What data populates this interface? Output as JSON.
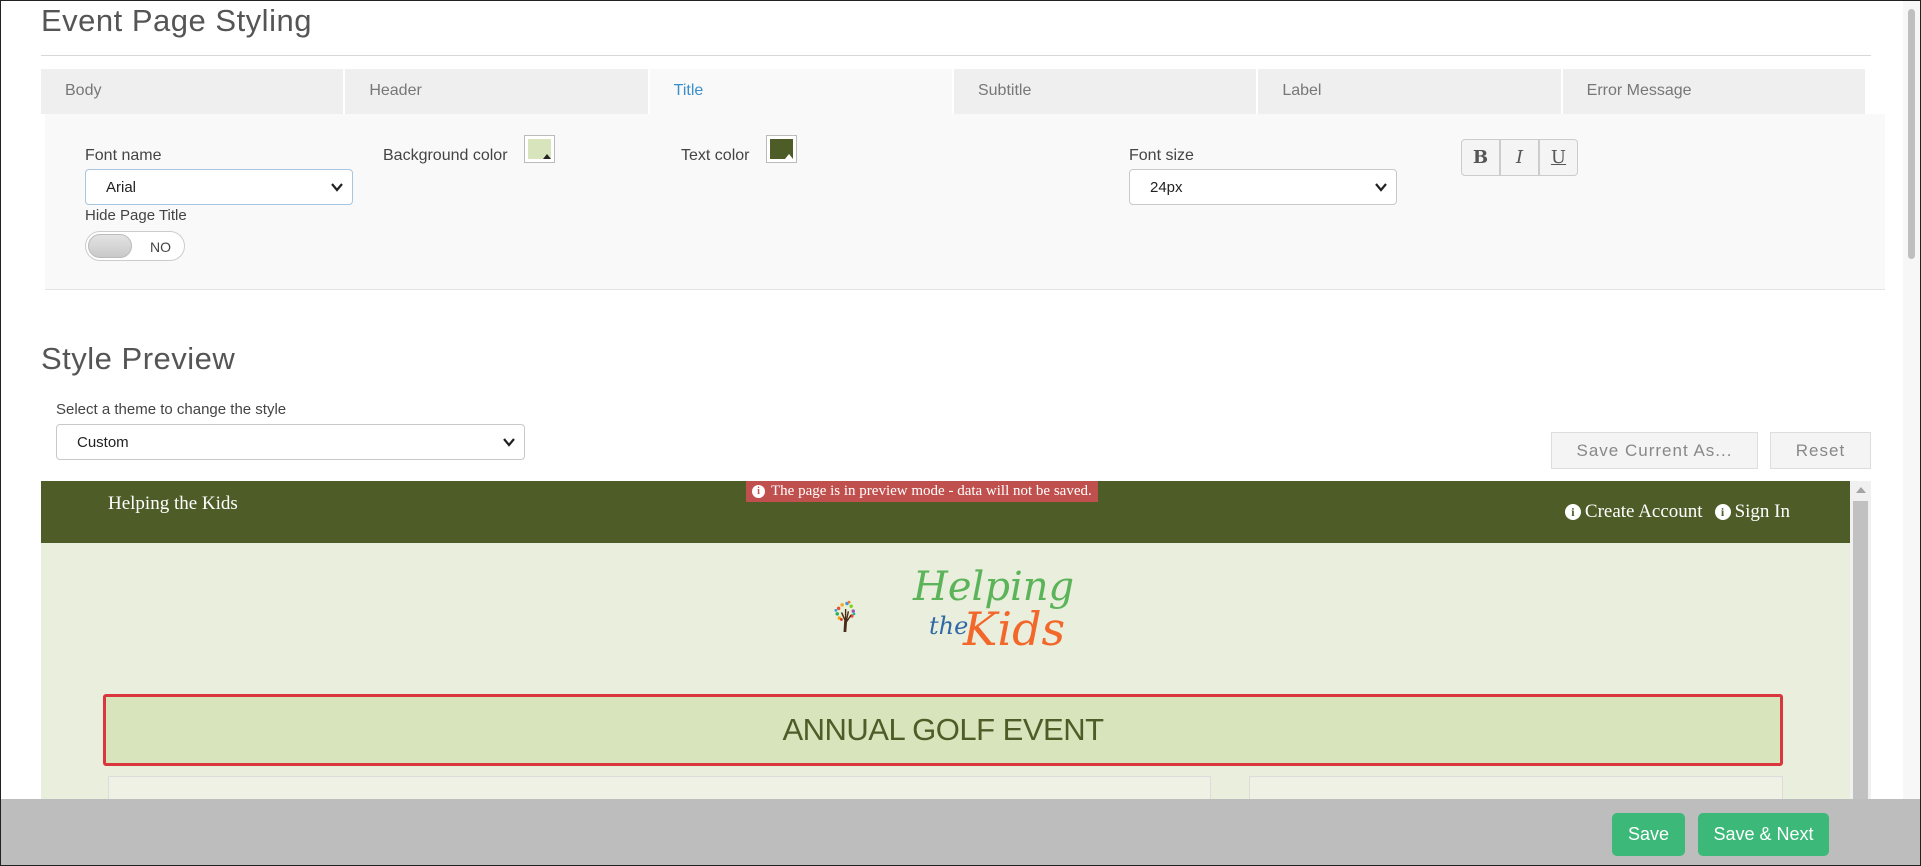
{
  "page": {
    "title": "Event Page Styling",
    "tabs": [
      {
        "label": "Body",
        "active": false
      },
      {
        "label": "Header",
        "active": false
      },
      {
        "label": "Title",
        "active": true
      },
      {
        "label": "Subtitle",
        "active": false
      },
      {
        "label": "Label",
        "active": false
      },
      {
        "label": "Error Message",
        "active": false
      }
    ]
  },
  "title_settings": {
    "font_name_label": "Font name",
    "font_name_value": "Arial",
    "background_color_label": "Background color",
    "background_color": "#d8e4bb",
    "text_color_label": "Text color",
    "text_color": "#4e5c28",
    "font_size_label": "Font size",
    "font_size_value": "24px",
    "format_buttons": {
      "bold": "B",
      "italic": "I",
      "underline": "U"
    },
    "hide_title_label": "Hide Page Title",
    "hide_title_value": "NO"
  },
  "preview": {
    "section_title": "Style Preview",
    "theme_label": "Select a theme to change the style",
    "theme_value": "Custom",
    "save_as_label": "Save Current As...",
    "reset_label": "Reset",
    "header_brand": "Helping the Kids",
    "mode_banner": "The page is in preview mode - data will not be saved.",
    "create_account": "Create Account",
    "sign_in": "Sign In",
    "logo": {
      "line1": "Helping",
      "the": "the",
      "kids": "Kids"
    },
    "event_title": "ANNUAL GOLF EVENT",
    "header_color": "#4e5c28",
    "banner_color": "#c0504d",
    "body_color": "#eaeedc"
  },
  "footer": {
    "save_label": "Save",
    "save_next_label": "Save & Next",
    "button_color": "#3cb878"
  }
}
